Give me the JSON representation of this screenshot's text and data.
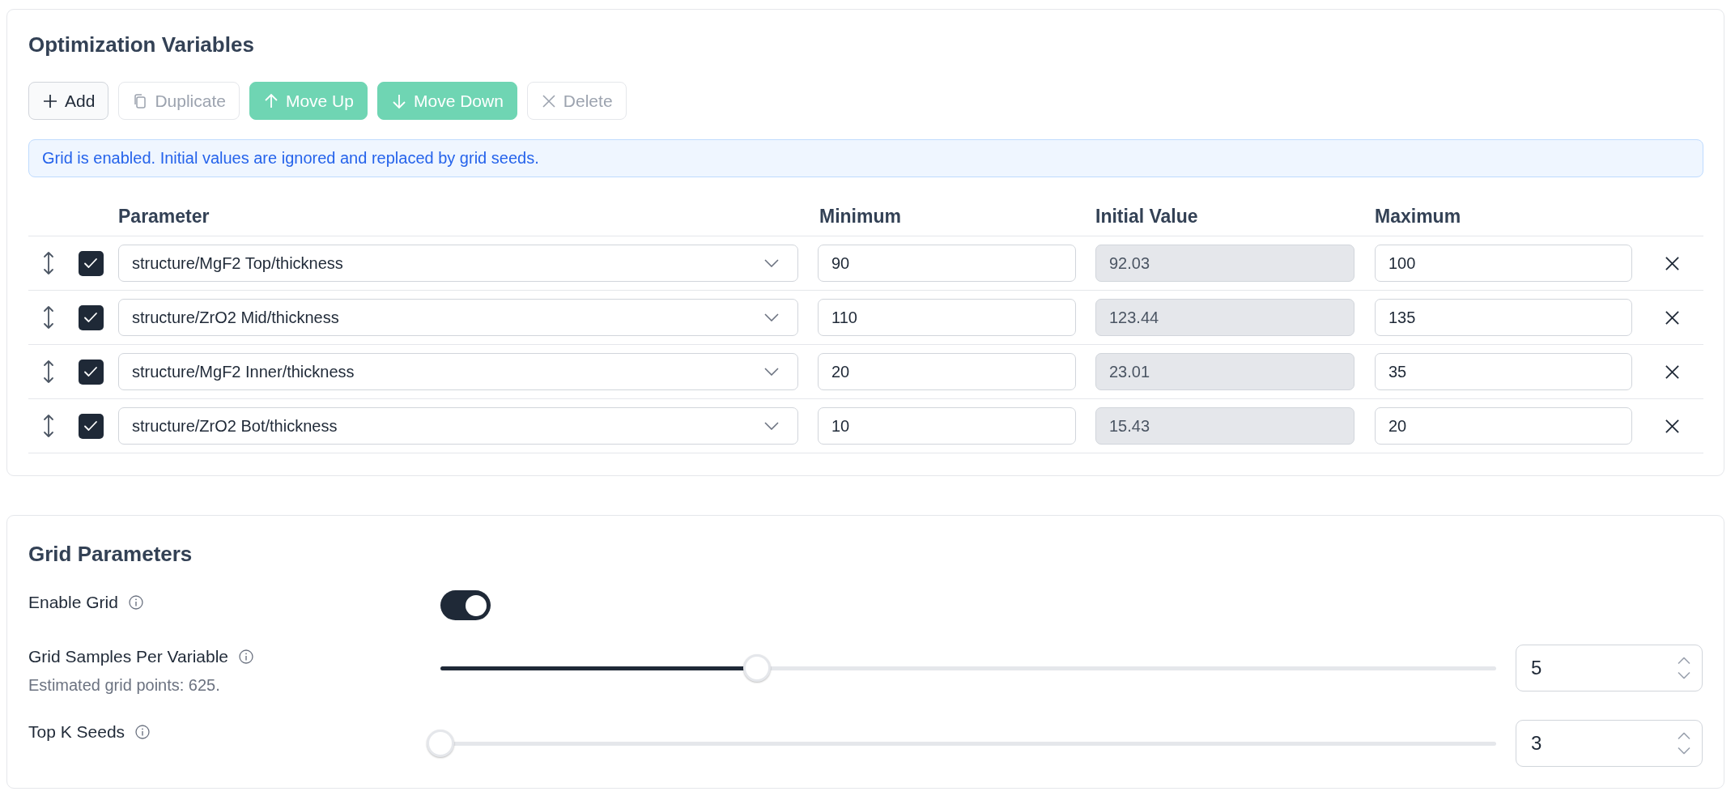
{
  "variables": {
    "title": "Optimization Variables",
    "toolbar": [
      {
        "kind": "add",
        "label": "Add",
        "disabled": false
      },
      {
        "kind": "duplicate",
        "label": "Duplicate",
        "disabled": true
      },
      {
        "kind": "move_up",
        "label": "Move Up",
        "disabled": false
      },
      {
        "kind": "move_down",
        "label": "Move Down",
        "disabled": false
      },
      {
        "kind": "delete",
        "label": "Delete",
        "disabled": true
      }
    ],
    "notice": "Grid is enabled. Initial values are ignored and replaced by grid seeds.",
    "table": {
      "columns": [
        "Parameter",
        "Minimum",
        "Initial Value",
        "Maximum"
      ],
      "rows": [
        {
          "checked": true,
          "parameter": "structure/MgF2 Top/thickness",
          "minimum": "90",
          "initial": {
            "value": "92.03",
            "disabled": true
          },
          "maximum": "100"
        },
        {
          "checked": true,
          "parameter": "structure/ZrO2 Mid/thickness",
          "minimum": "110",
          "initial": {
            "value": "123.44",
            "disabled": true
          },
          "maximum": "135"
        },
        {
          "checked": true,
          "parameter": "structure/MgF2 Inner/thickness",
          "minimum": "20",
          "initial": {
            "value": "23.01",
            "disabled": true
          },
          "maximum": "35"
        },
        {
          "checked": true,
          "parameter": "structure/ZrO2 Bot/thickness",
          "minimum": "10",
          "initial": {
            "value": "15.43",
            "disabled": true
          },
          "maximum": "20"
        }
      ]
    }
  },
  "grid": {
    "title": "Grid Parameters",
    "settings": [
      {
        "kind": "toggle",
        "label": "Enable Grid",
        "on": true
      },
      {
        "kind": "slider",
        "label": "Grid Samples Per Variable",
        "hint": "Estimated grid points: 625.",
        "level": 0.3,
        "value": "5"
      },
      {
        "kind": "slider",
        "label": "Top K Seeds",
        "level": 0,
        "value": "3"
      }
    ]
  }
}
